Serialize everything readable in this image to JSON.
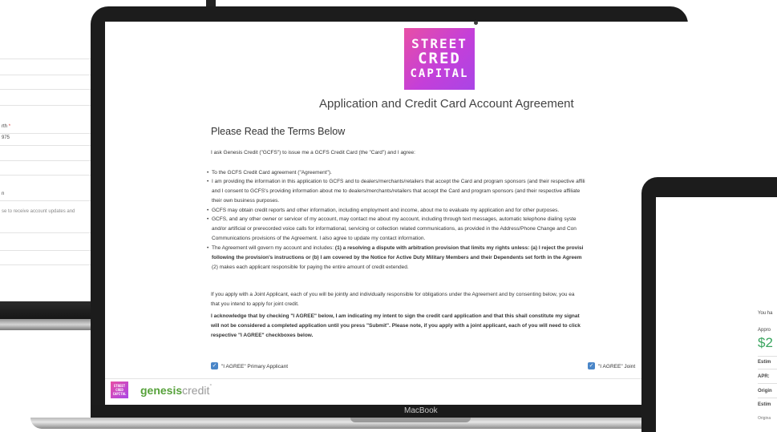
{
  "left_form": {
    "birth_label": "rth",
    "birth_value": "975",
    "n_value": "n",
    "updates_text": "se to receive account updates and"
  },
  "logo": {
    "line1": "STREET",
    "line2": "CRED",
    "line3": "CAPITAL"
  },
  "page": {
    "title": "Application and Credit Card Account Agreement",
    "section_title": "Please Read the Terms Below",
    "intro": "I ask Genesis Credit (\"GCFS\") to issue me a GCFS Credit Card (the \"Card\") and I agree:",
    "bullets": [
      [
        "To the GCFS Credit Card agreement (\"Agreement\")."
      ],
      [
        "I am providing the information in this application to GCFS and to dealers/merchants/retailers that accept the Card and program sponsors (and their respective affili",
        "and I consent to GCFS's providing information about me to dealers/merchants/retailers that accept the Card and program sponsors (and their respective affiliate",
        "their own business purposes."
      ],
      [
        "GCFS may obtain credit reports and other information, including employment and income, about me to evaluate my application and for other purposes."
      ],
      [
        "GCFS, and any other owner or servicer of my account, may contact me about my account, including through text messages, automatic telephone dialing syste",
        "and/or artificial or prerecorded voice calls for informational, servicing or collection related communications, as provided in the Address/Phone Change and Con",
        "Communications provisions of the Agreement. I also agree to update my contact information."
      ]
    ],
    "arb_line1_normal": "The Agreement will govern my account and includes: ",
    "arb_line1_bold": "(1) a resolving a dispute with arbitration provision that limits my rights unless: (a) I reject the provisi",
    "arb_line2_bold": "following the provision's instructions or (b) I am covered by the Notice for Active Duty Military Members and their Dependents set forth in the Agreem",
    "arb_line3": "(2) makes each applicant responsible for paying the entire amount of credit extended.",
    "joint_line1": "If you apply with a Joint Applicant, each of you will be jointly and individually responsible for obligations under the Agreement and by consenting below, you ea",
    "joint_line2": "that you intend to apply for joint credit.",
    "ack_line1": "I acknowledge that by checking \"I AGREE\" below, I am indicating my intent to sign the credit card application and that this shall constitute my signat",
    "ack_line2": "will not be considered a completed application until you press \"Submit\". Please note, if you apply with a joint applicant, each of you will need to click",
    "ack_line3": "respective \"I AGREE\" checkboxes below.",
    "primary_label": "\"I AGREE\" Primary Applicant",
    "joint_label": "\"I AGREE\" Joint",
    "checkmark": "✓"
  },
  "footer": {
    "mini_logo": [
      "STREET",
      "CRED",
      "CAPITAL"
    ],
    "brand_bold": "genesis",
    "brand_light": "credit",
    "trademark": "°"
  },
  "device_label": "MacBook",
  "right_device": {
    "line1": "You ha",
    "line2": "Appro",
    "amount": "$2",
    "row1": "Estim",
    "row2": "APR: ",
    "row3": "Origin",
    "row4": "Estim",
    "footnote": "Origina"
  },
  "colors": {
    "brand_pink": "#e84fa5",
    "brand_purple": "#a945e6",
    "checkbox": "#4a86c8",
    "genesis_green": "#56a13a",
    "amount_green": "#3aa55f"
  }
}
